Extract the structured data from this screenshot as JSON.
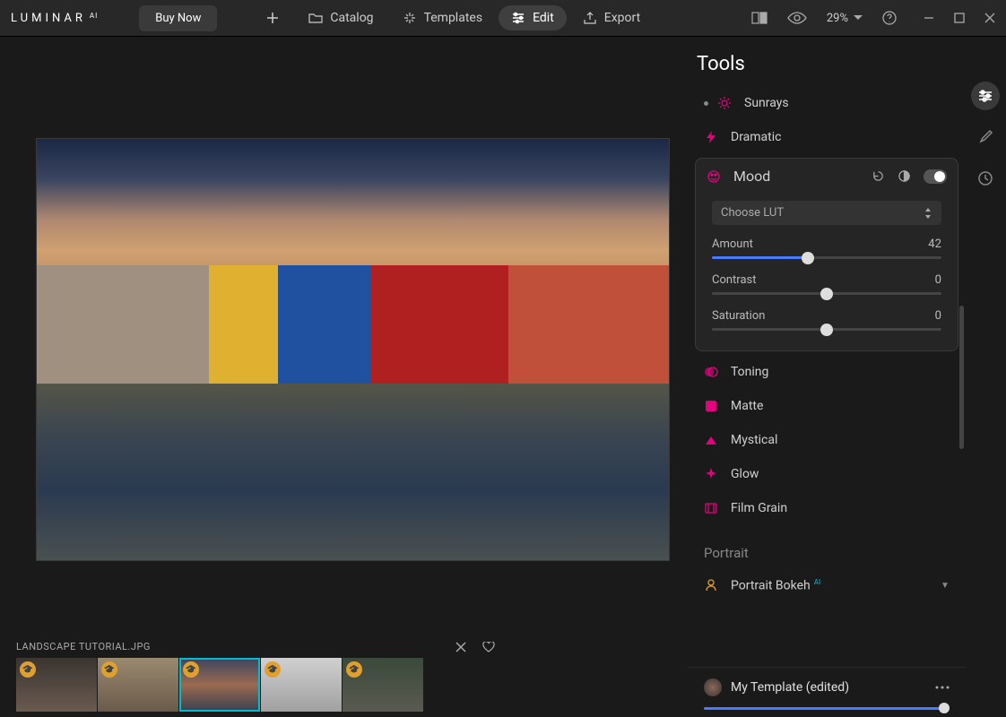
{
  "app": {
    "logo": "LUMINAR",
    "logo_suffix": "AI",
    "buy_now": "Buy Now"
  },
  "nav": {
    "catalog": "Catalog",
    "templates": "Templates",
    "edit": "Edit",
    "export": "Export"
  },
  "header": {
    "zoom": "29%"
  },
  "filmstrip": {
    "filename": "LANDSCAPE TUTORIAL.JPG"
  },
  "panel": {
    "title": "Tools",
    "tools": {
      "sunrays": "Sunrays",
      "dramatic": "Dramatic",
      "mood": "Mood",
      "toning": "Toning",
      "matte": "Matte",
      "mystical": "Mystical",
      "glow": "Glow",
      "film_grain": "Film Grain"
    },
    "mood": {
      "lut_placeholder": "Choose LUT",
      "amount_label": "Amount",
      "amount_value": "42",
      "contrast_label": "Contrast",
      "contrast_value": "0",
      "saturation_label": "Saturation",
      "saturation_value": "0"
    },
    "sections": {
      "portrait": "Portrait",
      "portrait_bokeh": "Portrait Bokeh"
    },
    "template": {
      "name": "My Template (edited)"
    }
  },
  "colors": {
    "accent_pink": "#e4007f",
    "accent_blue": "#4a7aff",
    "accent_cyan": "#00bcd4"
  }
}
